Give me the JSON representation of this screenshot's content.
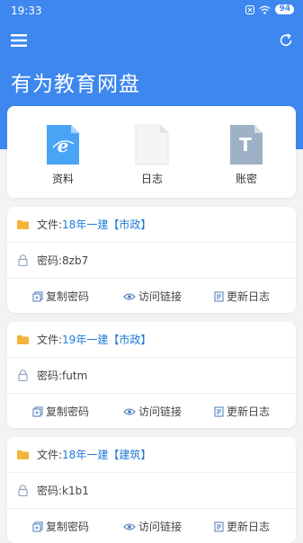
{
  "status_bar": {
    "time": "19:33",
    "battery": "94"
  },
  "header": {
    "title": "有为教育网盘"
  },
  "categories": [
    {
      "label": "资料",
      "icon": "ie-doc-icon"
    },
    {
      "label": "日志",
      "icon": "blank-doc-icon"
    },
    {
      "label": "账密",
      "icon": "text-doc-icon",
      "glyph": "T"
    }
  ],
  "files": [
    {
      "file_prefix": "文件: ",
      "file_name": "18年一建【市政】",
      "password_prefix": "密码: ",
      "password": "8zb7"
    },
    {
      "file_prefix": "文件: ",
      "file_name": "19年一建【市政】",
      "password_prefix": "密码: ",
      "password": "futm"
    },
    {
      "file_prefix": "文件: ",
      "file_name": "18年一建【建筑】",
      "password_prefix": "密码: ",
      "password": "k1b1"
    }
  ],
  "actions": {
    "copy": "复制密码",
    "visit": "访问链接",
    "log": "更新日志"
  },
  "colors": {
    "primary": "#3d87ee",
    "link": "#1f7ad6",
    "folder": "#f3b43c"
  }
}
